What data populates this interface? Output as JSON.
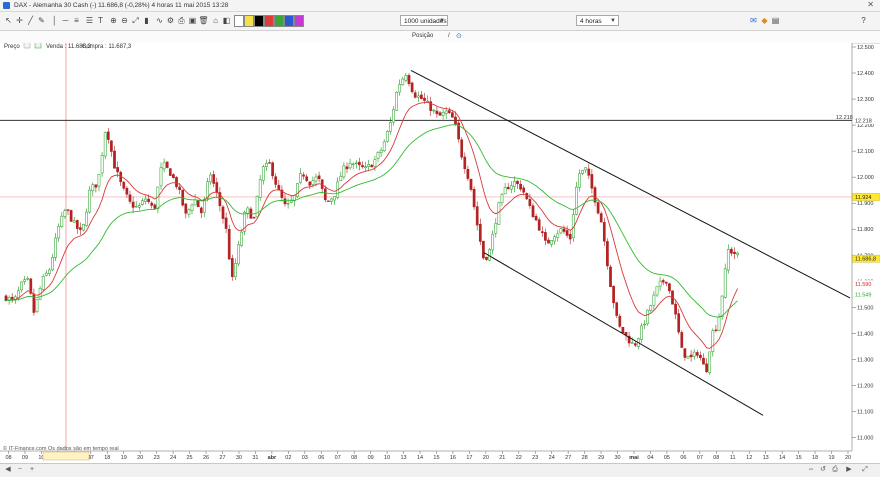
{
  "window": {
    "title": "DAX - Alemanha 30 Cash (-)    11.686,8 (-0,28%)    4 horas    11 mai 2015 13:28"
  },
  "toolbar": {
    "units_select": "1000 unidades",
    "timeframe_select": "4 horas"
  },
  "position_row": {
    "label": "Posição",
    "separator": "/"
  },
  "info_line": {
    "price_label": "Preço",
    "sell": "Venda : 11.686,3",
    "buy": "Compra : 11.687,3"
  },
  "disclaimer": "© IT-Finance.com  Os dados são em tempo real",
  "colors": {
    "up_candle": "#1a9a1a",
    "down_candle": "#b22222",
    "ma_red": "#d83a3a",
    "ma_green": "#33bb33",
    "hline": "#333333",
    "hline_pink": "#f2a0a0",
    "crosshair": "#f08080"
  },
  "chart_data": {
    "type": "candlestick",
    "y_range": [
      11000,
      12500
    ],
    "y_ticks": [
      "12.500",
      "12.400",
      "12.300",
      "12.200",
      "12.100",
      "12.000",
      "11.900",
      "11.800",
      "11.700",
      "11.600",
      "11.500",
      "11.400",
      "11.300",
      "11.200",
      "11.100",
      "11.000"
    ],
    "x_ticks": [
      "08",
      "09",
      "10",
      "12 mar 2015 08:00",
      "15",
      "17",
      "18",
      "19",
      "20",
      "23",
      "24",
      "25",
      "26",
      "27",
      "30",
      "31",
      "abr",
      "02",
      "03",
      "06",
      "07",
      "08",
      "09",
      "10",
      "13",
      "14",
      "15",
      "16",
      "17",
      "20",
      "21",
      "22",
      "23",
      "24",
      "27",
      "28",
      "29",
      "30",
      "mai",
      "04",
      "05",
      "06",
      "07",
      "08",
      "11",
      "12",
      "13",
      "14",
      "15",
      "18",
      "19",
      "20"
    ],
    "price_labels": [
      {
        "text": "12.218",
        "value": 12218,
        "bg": "#ffffff",
        "fg": "#333333"
      },
      {
        "text": "11.924",
        "value": 11924,
        "bg": "#ffe830",
        "fg": "#222222"
      },
      {
        "text": "11.686,8",
        "value": 11686.8,
        "bg": "#ffe830",
        "fg": "#222222"
      },
      {
        "text": "11.590",
        "value": 11590,
        "bg": "#ffffff",
        "fg": "#cc2222"
      },
      {
        "text": "11.549",
        "value": 11549,
        "bg": "#ffffff",
        "fg": "#22aa22"
      }
    ],
    "horizontal_lines": [
      {
        "value": 12218,
        "style": "solid"
      },
      {
        "value": 11924,
        "style": "pink"
      }
    ],
    "trendlines": [
      {
        "from": {
          "x_index": 411,
          "value": 12410
        },
        "to": {
          "x_index": 850,
          "value": 11536
        }
      },
      {
        "from": {
          "x_index": 484,
          "value": 11710
        },
        "to": {
          "x_index": 763,
          "value": 11085
        }
      }
    ],
    "keypoints": [
      [
        6,
        11540
      ],
      [
        14,
        11520
      ],
      [
        22,
        11590
      ],
      [
        28,
        11600
      ],
      [
        34,
        11480
      ],
      [
        42,
        11600
      ],
      [
        50,
        11650
      ],
      [
        58,
        11800
      ],
      [
        66,
        11880
      ],
      [
        74,
        11820
      ],
      [
        82,
        11780
      ],
      [
        90,
        11950
      ],
      [
        98,
        11980
      ],
      [
        106,
        12200
      ],
      [
        114,
        12050
      ],
      [
        122,
        11960
      ],
      [
        130,
        11900
      ],
      [
        138,
        11880
      ],
      [
        146,
        11920
      ],
      [
        154,
        11870
      ],
      [
        162,
        12050
      ],
      [
        170,
        12020
      ],
      [
        178,
        11960
      ],
      [
        186,
        11850
      ],
      [
        194,
        11920
      ],
      [
        202,
        11860
      ],
      [
        210,
        12020
      ],
      [
        218,
        11920
      ],
      [
        226,
        11800
      ],
      [
        232,
        11600
      ],
      [
        238,
        11720
      ],
      [
        246,
        11880
      ],
      [
        254,
        11840
      ],
      [
        262,
        12030
      ],
      [
        270,
        12050
      ],
      [
        278,
        11950
      ],
      [
        286,
        11880
      ],
      [
        294,
        11920
      ],
      [
        302,
        12020
      ],
      [
        310,
        11980
      ],
      [
        318,
        12000
      ],
      [
        326,
        11900
      ],
      [
        334,
        11930
      ],
      [
        342,
        12020
      ],
      [
        350,
        12060
      ],
      [
        358,
        12040
      ],
      [
        366,
        12030
      ],
      [
        374,
        12060
      ],
      [
        382,
        12110
      ],
      [
        390,
        12200
      ],
      [
        398,
        12350
      ],
      [
        406,
        12400
      ],
      [
        414,
        12320
      ],
      [
        422,
        12300
      ],
      [
        430,
        12270
      ],
      [
        438,
        12230
      ],
      [
        446,
        12250
      ],
      [
        454,
        12220
      ],
      [
        462,
        12080
      ],
      [
        470,
        11980
      ],
      [
        478,
        11800
      ],
      [
        484,
        11680
      ],
      [
        490,
        11720
      ],
      [
        498,
        11880
      ],
      [
        506,
        11960
      ],
      [
        514,
        11980
      ],
      [
        522,
        11960
      ],
      [
        530,
        11880
      ],
      [
        538,
        11820
      ],
      [
        546,
        11740
      ],
      [
        554,
        11780
      ],
      [
        562,
        11800
      ],
      [
        570,
        11760
      ],
      [
        578,
        12010
      ],
      [
        586,
        12030
      ],
      [
        594,
        11930
      ],
      [
        602,
        11820
      ],
      [
        610,
        11600
      ],
      [
        618,
        11430
      ],
      [
        626,
        11390
      ],
      [
        634,
        11350
      ],
      [
        642,
        11420
      ],
      [
        650,
        11500
      ],
      [
        658,
        11580
      ],
      [
        666,
        11610
      ],
      [
        674,
        11500
      ],
      [
        682,
        11330
      ],
      [
        690,
        11300
      ],
      [
        698,
        11330
      ],
      [
        706,
        11250
      ],
      [
        712,
        11400
      ],
      [
        718,
        11440
      ],
      [
        724,
        11600
      ],
      [
        728,
        11720
      ],
      [
        734,
        11710
      ],
      [
        740,
        11690
      ]
    ]
  }
}
